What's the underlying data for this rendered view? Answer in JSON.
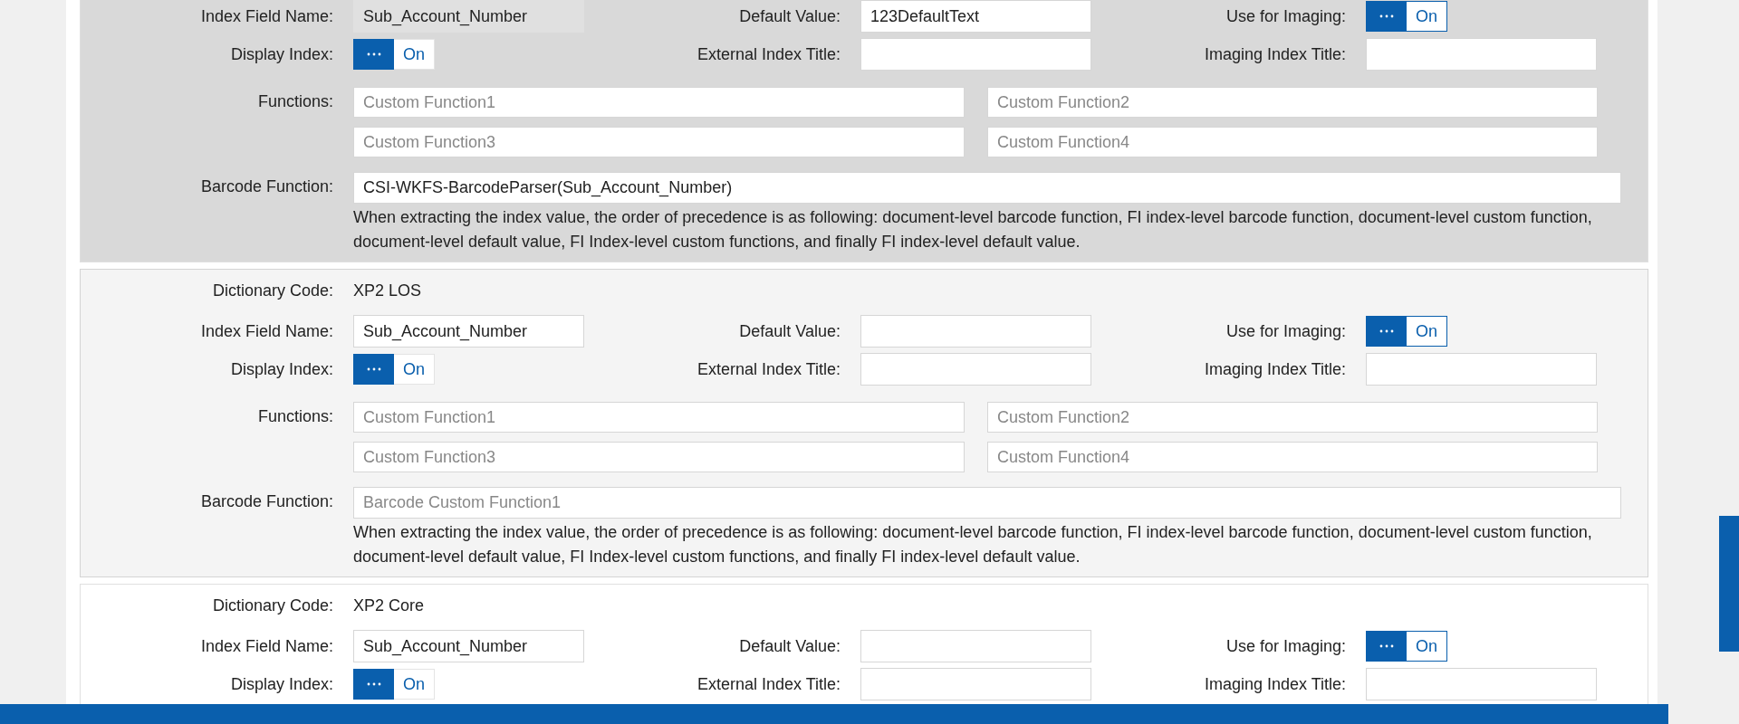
{
  "cards": [
    {
      "selected": true,
      "hovered": false,
      "rows": [
        {
          "kind": "fields",
          "cells": [
            {
              "label": "Index Field Name:",
              "kind": "input",
              "value": "Sub_Account_Number",
              "disabled": true
            },
            {
              "label": "Default Value:",
              "kind": "input",
              "value": "123DefaultText"
            },
            {
              "label": "Use for Imaging:",
              "kind": "toggle",
              "on": true,
              "text": "On",
              "focused": true
            }
          ]
        },
        {
          "kind": "fields",
          "cells": [
            {
              "label": "Display Index:",
              "kind": "toggle",
              "on": true,
              "text": "On",
              "focused": false
            },
            {
              "label": "External Index Title:",
              "kind": "input"
            },
            {
              "label": "Imaging Index Title:",
              "kind": "input"
            }
          ]
        },
        {
          "kind": "functions",
          "label": "Functions:",
          "inputs": [
            {
              "placeholder": "Custom Function1"
            },
            {
              "placeholder": "Custom Function2"
            },
            {
              "placeholder": "Custom Function3"
            },
            {
              "placeholder": "Custom Function4"
            }
          ]
        },
        {
          "kind": "barcode",
          "label": "Barcode Function:",
          "value": "CSI-WKFS-BarcodeParser(Sub_Account_Number)",
          "note": "When extracting the index value, the order of precedence is as following: document-level barcode function, FI index-level barcode function, document-level custom function, document-level default value, FI Index-level custom functions, and finally FI index-level default value."
        }
      ]
    },
    {
      "selected": false,
      "hovered": true,
      "rows": [
        {
          "kind": "text",
          "label": "Dictionary Code:",
          "value": "XP2 LOS"
        },
        {
          "kind": "fields",
          "cells": [
            {
              "label": "Index Field Name:",
              "kind": "input",
              "value": "Sub_Account_Number",
              "disabled": false
            },
            {
              "label": "Default Value:",
              "kind": "input"
            },
            {
              "label": "Use for Imaging:",
              "kind": "toggle",
              "on": true,
              "text": "On",
              "focused": true
            }
          ]
        },
        {
          "kind": "fields",
          "cells": [
            {
              "label": "Display Index:",
              "kind": "toggle",
              "on": true,
              "text": "On",
              "focused": false
            },
            {
              "label": "External Index Title:",
              "kind": "input"
            },
            {
              "label": "Imaging Index Title:",
              "kind": "input"
            }
          ]
        },
        {
          "kind": "functions",
          "label": "Functions:",
          "inputs": [
            {
              "placeholder": "Custom Function1"
            },
            {
              "placeholder": "Custom Function2"
            },
            {
              "placeholder": "Custom Function3"
            },
            {
              "placeholder": "Custom Function4"
            }
          ]
        },
        {
          "kind": "barcode",
          "label": "Barcode Function:",
          "placeholder": "Barcode Custom Function1",
          "note": "When extracting the index value, the order of precedence is as following: document-level barcode function, FI index-level barcode function, document-level custom function, document-level default value, FI Index-level custom functions, and finally FI index-level default value."
        }
      ]
    },
    {
      "selected": false,
      "hovered": false,
      "rows": [
        {
          "kind": "text",
          "label": "Dictionary Code:",
          "value": "XP2 Core"
        },
        {
          "kind": "fields",
          "cells": [
            {
              "label": "Index Field Name:",
              "kind": "input",
              "value": "Sub_Account_Number",
              "disabled": false
            },
            {
              "label": "Default Value:",
              "kind": "input"
            },
            {
              "label": "Use for Imaging:",
              "kind": "toggle",
              "on": true,
              "text": "On",
              "focused": true
            }
          ]
        },
        {
          "kind": "fields",
          "cells": [
            {
              "label": "Display Index:",
              "kind": "toggle",
              "on": true,
              "text": "On",
              "focused": false
            },
            {
              "label": "External Index Title:",
              "kind": "input"
            },
            {
              "label": "Imaging Index Title:",
              "kind": "input"
            }
          ]
        }
      ]
    }
  ]
}
